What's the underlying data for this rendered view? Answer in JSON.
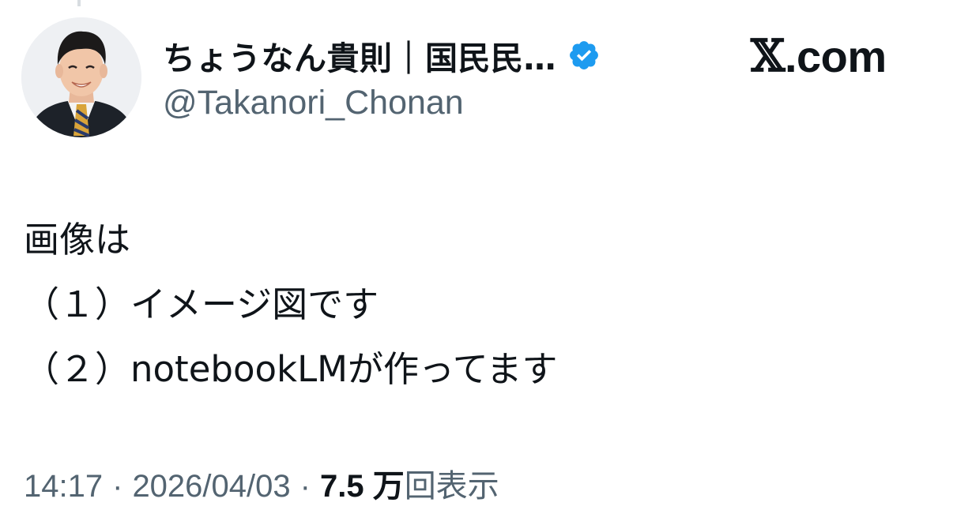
{
  "author": {
    "display_name": "ちょうなん貴則｜国民民…",
    "handle": "@Takanori_Chonan",
    "verified": true,
    "verified_icon": "verified-badge-icon",
    "avatar": "profile-photo-avatar"
  },
  "brand": {
    "x_letter": "𝕏",
    "domain": ".com"
  },
  "tweet": {
    "lines": [
      "画像は",
      "（１）イメージ図です",
      "（２）notebookLMが作ってます"
    ]
  },
  "meta": {
    "time": "14:17",
    "date": "2026/04/03",
    "separator": "·",
    "views_count": "7.5 万",
    "views_label": "回表示"
  },
  "colors": {
    "text": "#0f1419",
    "secondary_text": "#536471",
    "verified_blue": "#1d9bf0",
    "background": "#ffffff"
  }
}
